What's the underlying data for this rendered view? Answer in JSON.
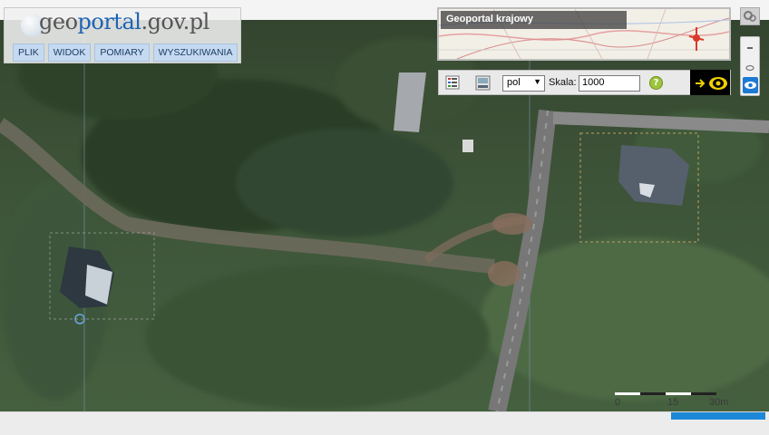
{
  "logo": {
    "prefix": "geo",
    "highlight": "portal",
    "suffix": ".gov.pl"
  },
  "menu": {
    "items": [
      "PLIK",
      "WIDOK",
      "POMIARY",
      "WYSZUKIWANIA"
    ]
  },
  "overview": {
    "title": "Geoportal krajowy"
  },
  "toolbar": {
    "language": "pol",
    "scale_label": "Skala:",
    "scale_value": "1000",
    "help": "?"
  },
  "scalebar": {
    "labels": [
      "0",
      "15",
      "30m"
    ]
  },
  "colors": {
    "accent": "#1e88d8",
    "menu_bg": "#c5daf0",
    "help": "#9cc53a",
    "eye": "#f0d000"
  },
  "icons": [
    "legend-icon",
    "wms-icon",
    "help-icon",
    "arrow-icon",
    "eye-icon",
    "settings-icon",
    "zoom-out-icon"
  ]
}
